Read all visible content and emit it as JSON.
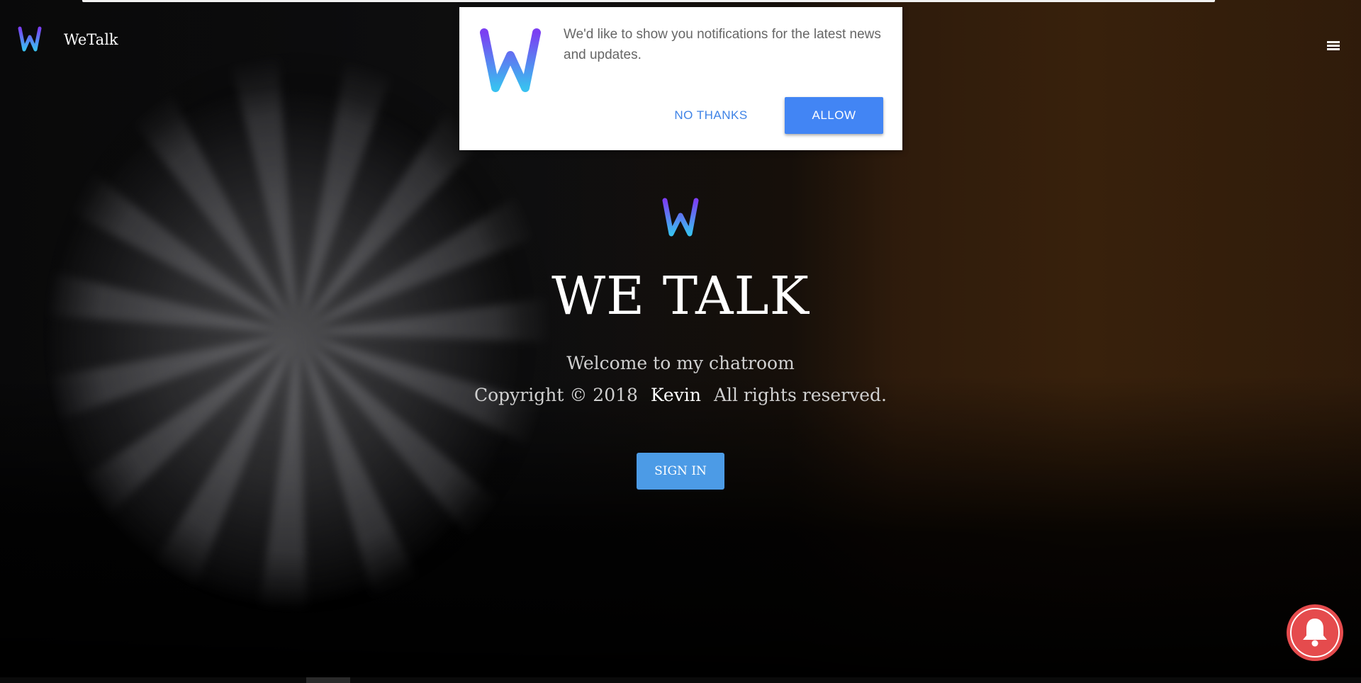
{
  "header": {
    "brand_name": "WeTalk",
    "logo_icon": "wetalk-w-logo-icon",
    "menu_icon": "hamburger-menu-icon"
  },
  "notification_prompt": {
    "message": "We'd like to show you notifications for the latest news and updates.",
    "no_thanks_label": "NO THANKS",
    "allow_label": "ALLOW",
    "logo_icon": "wetalk-w-logo-icon",
    "colors": {
      "allow_button": "#4285f4",
      "no_thanks_text": "#3f83e6"
    }
  },
  "hero": {
    "logo_icon": "wetalk-w-logo-icon",
    "title": "WE TALK",
    "subtitle": "Welcome to my chatroom",
    "copyright_prefix": "Copyright © 2018",
    "author": "Kevin",
    "copyright_suffix": "All rights reserved.",
    "sign_in_label": "SIGN IN",
    "colors": {
      "sign_in_button": "#4c9be6"
    }
  },
  "bell": {
    "icon": "notification-bell-icon",
    "color": "#e54b4d"
  }
}
